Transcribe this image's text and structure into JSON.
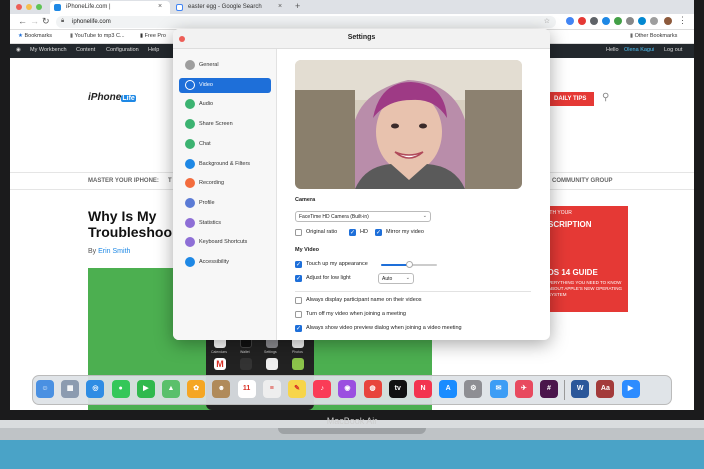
{
  "browser": {
    "tabs": [
      {
        "title": "iPhoneLife.com |",
        "active": true
      },
      {
        "title": "easter egg - Google Search",
        "active": false
      }
    ],
    "new_tab": "+",
    "close_glyph": "×",
    "url": "iphonelife.com",
    "bookmarks": [
      {
        "label": "Bookmarks"
      },
      {
        "label": "YouTube to mp3 C..."
      },
      {
        "label": "Free Pro"
      }
    ],
    "other_bookmarks": "Other Bookmarks"
  },
  "wp_admin": {
    "items": [
      "My Workbench",
      "Content",
      "Configuration",
      "Help"
    ],
    "greeting": "Hello",
    "user": "Olena Kagui",
    "logout": "Log out"
  },
  "website": {
    "logo_text": "iPhone",
    "logo_badge": "Life",
    "daily_tips": "DAILY TIPS",
    "nav_left": "MASTER YOUR IPHONE:",
    "nav_left_cut": "T",
    "nav_right": "COMMUNITY GROUP",
    "headline_lines": [
      "Why Is My",
      "Troubleshoo"
    ],
    "byline_prefix": "By",
    "author": "Erin Smith",
    "ad": {
      "line1": "ITH YOUR",
      "line2": "SCRIPTION",
      "line3": "DS 14 GUIDE",
      "line4": "VERYTHING YOU NEED TO KNOW ABOUT APPLE'S NEW OPERATING SYSTEM"
    },
    "phone_labels": [
      "Calendars",
      "Wallet",
      "Settings",
      "Photos"
    ]
  },
  "settings": {
    "title": "Settings",
    "sidebar": [
      {
        "label": "General",
        "icon": "gear-icon",
        "color": "#9e9e9e",
        "active": false
      },
      {
        "label": "Video",
        "icon": "video-camera-icon",
        "color": "#ffffff",
        "active": true
      },
      {
        "label": "Audio",
        "icon": "headphones-icon",
        "color": "#3cb371",
        "active": false
      },
      {
        "label": "Share Screen",
        "icon": "share-screen-icon",
        "color": "#3cb371",
        "active": false
      },
      {
        "label": "Chat",
        "icon": "chat-bubble-icon",
        "color": "#3cb371",
        "active": false
      },
      {
        "label": "Background & Filters",
        "icon": "background-filter-icon",
        "color": "#1e88e5",
        "active": false
      },
      {
        "label": "Recording",
        "icon": "recording-icon",
        "color": "#f36c3d",
        "active": false
      },
      {
        "label": "Profile",
        "icon": "profile-icon",
        "color": "#5b7bd5",
        "active": false
      },
      {
        "label": "Statistics",
        "icon": "statistics-icon",
        "color": "#8e6fd6",
        "active": false
      },
      {
        "label": "Keyboard Shortcuts",
        "icon": "keyboard-icon",
        "color": "#8e6fd6",
        "active": false
      },
      {
        "label": "Accessibility",
        "icon": "accessibility-icon",
        "color": "#1e88e5",
        "active": false
      }
    ],
    "camera_label": "Camera",
    "camera_value": "FaceTime HD Camera (Built-in)",
    "options_row": [
      {
        "label": "Original ratio",
        "checked": false
      },
      {
        "label": "HD",
        "checked": true
      },
      {
        "label": "Mirror my video",
        "checked": true
      }
    ],
    "my_video_label": "My Video",
    "touch_up": {
      "label": "Touch up my appearance",
      "checked": true,
      "level": 0.5
    },
    "low_light": {
      "label": "Adjust for low light",
      "checked": true,
      "value": "Auto"
    },
    "bottom_options": [
      {
        "label": "Always display participant name on their videos",
        "checked": false
      },
      {
        "label": "Turn off my video when joining a meeting",
        "checked": false
      },
      {
        "label": "Always show video preview dialog when joining a video meeting",
        "checked": true
      }
    ]
  },
  "dock": {
    "apps": [
      {
        "icon": "finder-icon",
        "color": "#4a90e2",
        "glyph": "☺"
      },
      {
        "icon": "launchpad-icon",
        "color": "#8c9bb0",
        "glyph": "▦"
      },
      {
        "icon": "safari-icon",
        "color": "#2f8de4",
        "glyph": "◎"
      },
      {
        "icon": "messages-icon",
        "color": "#34c759",
        "glyph": "●"
      },
      {
        "icon": "facetime-icon",
        "color": "#30b94d",
        "glyph": "▶"
      },
      {
        "icon": "maps-icon",
        "color": "#5ac06b",
        "glyph": "▲"
      },
      {
        "icon": "photos-icon",
        "color": "#f5a623",
        "glyph": "✿"
      },
      {
        "icon": "contacts-icon",
        "color": "#b08a5a",
        "glyph": "☻"
      },
      {
        "icon": "calendar-icon",
        "color": "#ffffff",
        "glyph": "11"
      },
      {
        "icon": "reminders-icon",
        "color": "#eeeeee",
        "glyph": "≡"
      },
      {
        "icon": "notes-icon",
        "color": "#f7d54a",
        "glyph": "✎"
      },
      {
        "icon": "music-icon",
        "color": "#fa3c57",
        "glyph": "♪"
      },
      {
        "icon": "podcasts-icon",
        "color": "#9b4fe0",
        "glyph": "◉"
      },
      {
        "icon": "chrome-icon",
        "color": "#e8453c",
        "glyph": "◍"
      },
      {
        "icon": "appletv-icon",
        "color": "#111111",
        "glyph": "tv"
      },
      {
        "icon": "news-icon",
        "color": "#f3344f",
        "glyph": "N"
      },
      {
        "icon": "appstore-icon",
        "color": "#1a8cff",
        "glyph": "A"
      },
      {
        "icon": "system-preferences-icon",
        "color": "#8e8e93",
        "glyph": "⚙"
      },
      {
        "icon": "mail-icon",
        "color": "#3d9df5",
        "glyph": "✉"
      },
      {
        "icon": "airmail-icon",
        "color": "#e84a5f",
        "glyph": "✈"
      },
      {
        "icon": "slack-icon",
        "color": "#4a154b",
        "glyph": "#"
      },
      {
        "icon": "word-icon",
        "color": "#2b579a",
        "glyph": "W"
      },
      {
        "icon": "dictionary-icon",
        "color": "#a33b3b",
        "glyph": "Aa"
      },
      {
        "icon": "zoom-icon",
        "color": "#2d8cff",
        "glyph": "▶"
      }
    ]
  },
  "laptop": {
    "label": "MacBook Air"
  }
}
